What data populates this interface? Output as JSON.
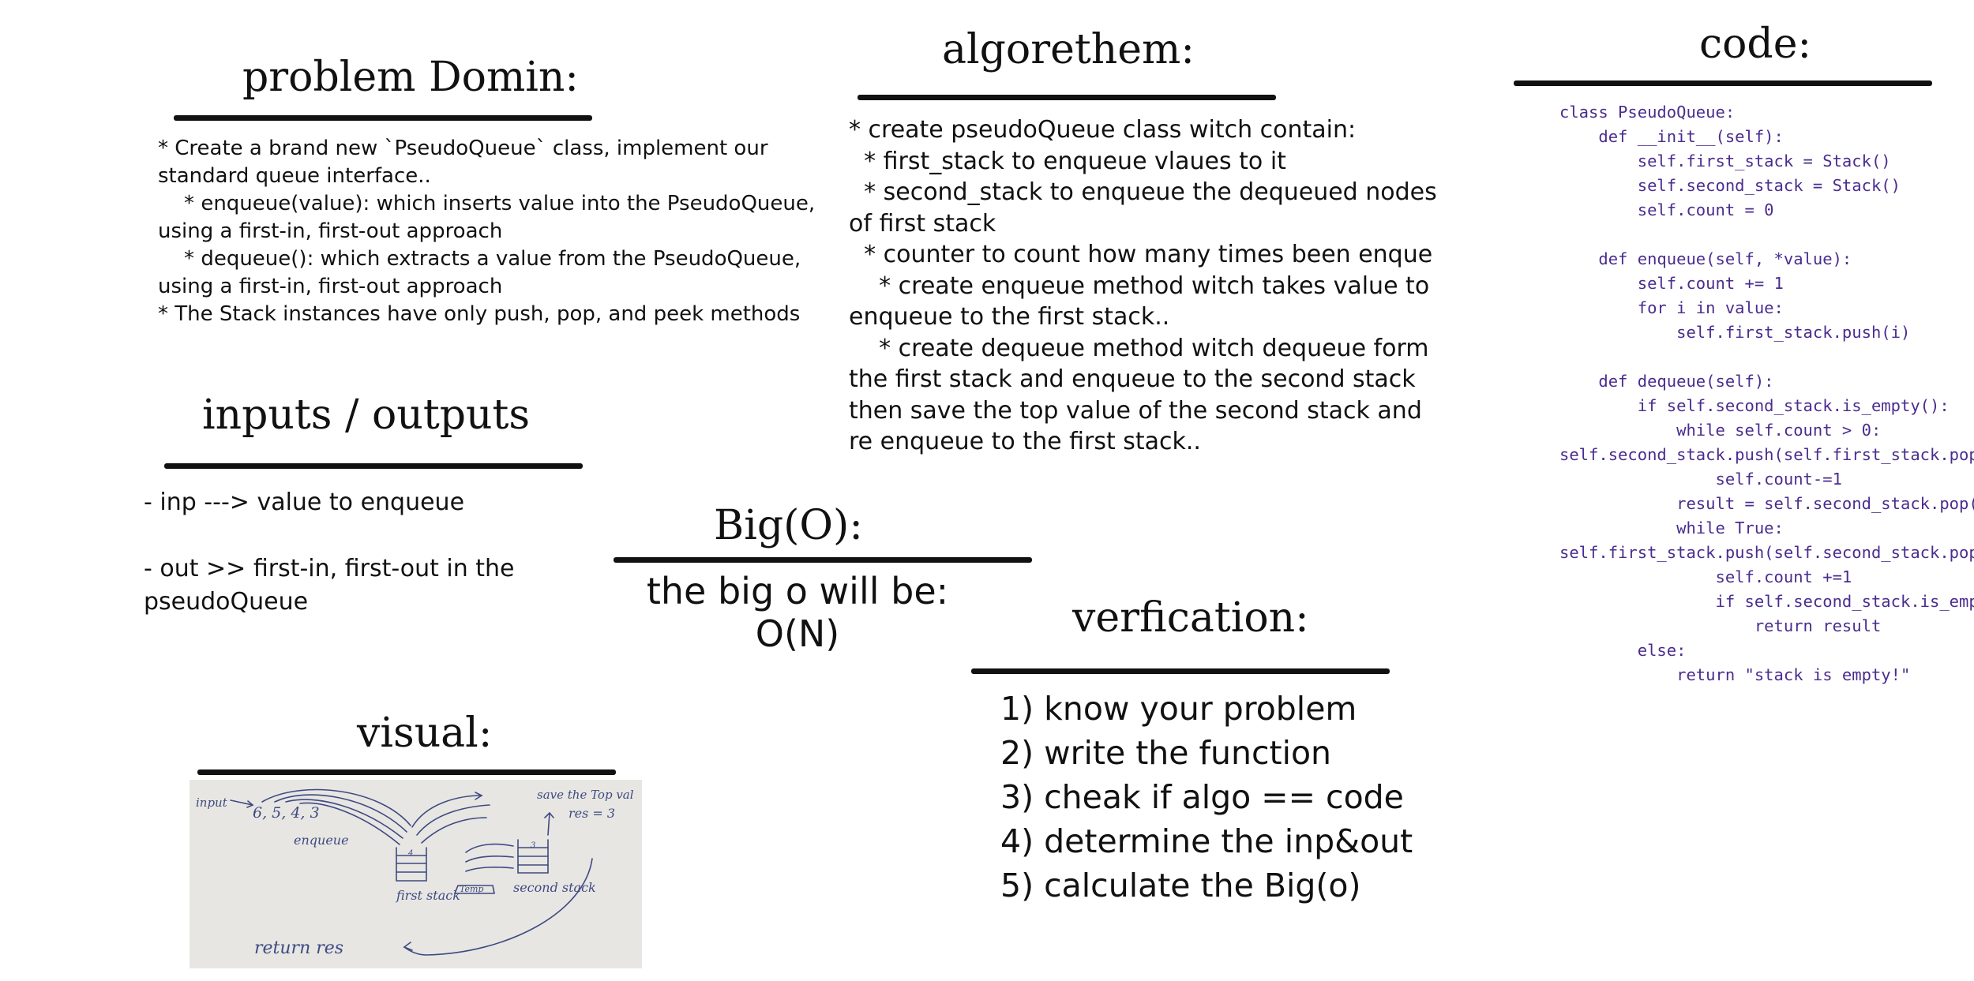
{
  "problem": {
    "title": "problem Domin:",
    "lines": [
      "* Create a brand new `PseudoQueue` class, implement our",
      "standard queue interface..",
      "    * enqueue(value): which inserts value into the PseudoQueue,",
      "using a first-in, first-out approach",
      "    * dequeue(): which extracts a value from the PseudoQueue,",
      "using a first-in, first-out approach",
      "* The Stack instances have only push, pop, and peek methods"
    ]
  },
  "io": {
    "title": "inputs / outputs",
    "lines": [
      "- inp ---> value to enqueue",
      "",
      "- out >> first-in, first-out in the",
      "pseudoQueue"
    ]
  },
  "algorithm": {
    "title": "algorethem:",
    "lines": [
      "* create pseudoQueue class witch contain:",
      "  * first_stack to enqueue vlaues to it",
      "  * second_stack to enqueue the dequeued nodes",
      "of first stack",
      "  * counter to count how many times been enque",
      "    * create enqueue method witch takes value to",
      "enqueue to the first stack..",
      "    * create dequeue method witch dequeue form",
      "the first stack and enqueue to the second stack",
      "then save the top value of the second stack and",
      "re enqueue to the first stack.."
    ]
  },
  "code": {
    "title": "code:",
    "lines": [
      "class PseudoQueue:",
      "    def __init__(self):",
      "        self.first_stack = Stack()",
      "        self.second_stack = Stack()",
      "        self.count = 0",
      "",
      "    def enqueue(self, *value):",
      "        self.count += 1",
      "        for i in value:",
      "            self.first_stack.push(i)",
      "",
      "    def dequeue(self):",
      "        if self.second_stack.is_empty():",
      "            while self.count > 0:",
      "self.second_stack.push(self.first_stack.pop())",
      "                self.count-=1",
      "            result = self.second_stack.pop()",
      "            while True:",
      "self.first_stack.push(self.second_stack.pop())",
      "                self.count +=1",
      "                if self.second_stack.is_empty():",
      "                    return result",
      "        else:",
      "            return \"stack is empty!\""
    ]
  },
  "bigo": {
    "title": "Big(O):",
    "lines": [
      "the big o will be:",
      "O(N)"
    ]
  },
  "verification": {
    "title": "verfication:",
    "lines": [
      "1) know your problem",
      "2) write the function",
      "3) cheak if algo == code",
      "4) determine the inp&out",
      "5) calculate the Big(o)"
    ]
  },
  "visual": {
    "title": "visual:",
    "sketch": {
      "input_label": "input",
      "input_values": "6, 5, 4, 3",
      "enqueue_label": "enqueue",
      "first_stack_label": "first stack",
      "first_stack_top": "4",
      "temp_label": "Temp",
      "second_stack_label": "second stack",
      "second_stack_top": "3",
      "save_note": "save the Top val",
      "res_note": "res = 3",
      "return_note": "return res"
    }
  },
  "colors": {
    "text": "#111111",
    "code_text": "#4b2c8f",
    "rule": "#111111",
    "sketch_ink": "#3e4a82",
    "paper": "#e7e6e2"
  }
}
